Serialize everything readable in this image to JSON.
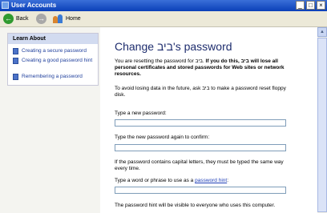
{
  "window": {
    "title": "User Accounts",
    "minimize": "_",
    "maximize": "□",
    "close": "×"
  },
  "toolbar": {
    "back_label": "Back",
    "home_label": "Home"
  },
  "learn_about": {
    "header": "Learn About",
    "items": [
      {
        "label": "Creating a secure password"
      },
      {
        "label": "Creating a good password hint"
      },
      {
        "label": "Remembering a password"
      }
    ]
  },
  "main": {
    "title": "Change ביב's password",
    "para1_normal": "You are resetting the password for ביב. ",
    "para1_bold": "If you do this, ביב will lose all personal certificates and stored passwords for Web sites or network resources.",
    "para2": "To avoid losing data in the future, ask ביב to make a password reset floppy disk.",
    "new_password_label": "Type a new password:",
    "new_password_value": "",
    "confirm_label": "Type the new password again to confirm:",
    "confirm_value": "",
    "caps_note": "If the password contains capital letters, they must be typed the same way every time.",
    "hint_label_prefix": "Type a word or phrase to use as a ",
    "hint_link": "password hint",
    "hint_label_suffix": ":",
    "hint_value": "",
    "hint_visibility_note": "The password hint will be visible to everyone who uses this computer."
  }
}
